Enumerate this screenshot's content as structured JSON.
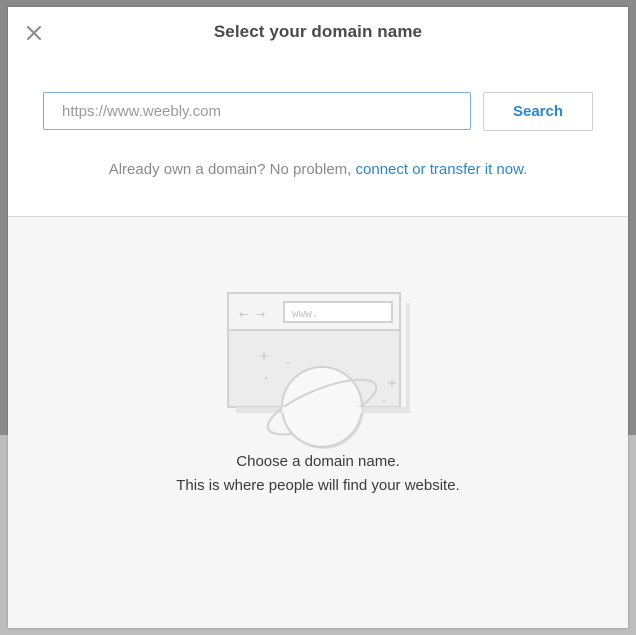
{
  "dialog": {
    "title": "Select your domain name",
    "close_icon": "close-icon"
  },
  "search": {
    "placeholder": "https://www.weebly.com",
    "value": "",
    "button_label": "Search"
  },
  "hint": {
    "prefix": "Already own a domain? No problem, ",
    "link_text": "connect or transfer it now",
    "suffix": "."
  },
  "illustration": {
    "icon": "browser-planet-icon",
    "url_bar_text": "www.",
    "back_arrow": "←",
    "forward_arrow": "→"
  },
  "empty_state": {
    "title": "Choose a domain name.",
    "subtitle": "This is where people will find your website."
  },
  "colors": {
    "accent": "#2a86d2",
    "input_border": "#7fb2d8",
    "panel_bg": "#f6f6f6"
  }
}
